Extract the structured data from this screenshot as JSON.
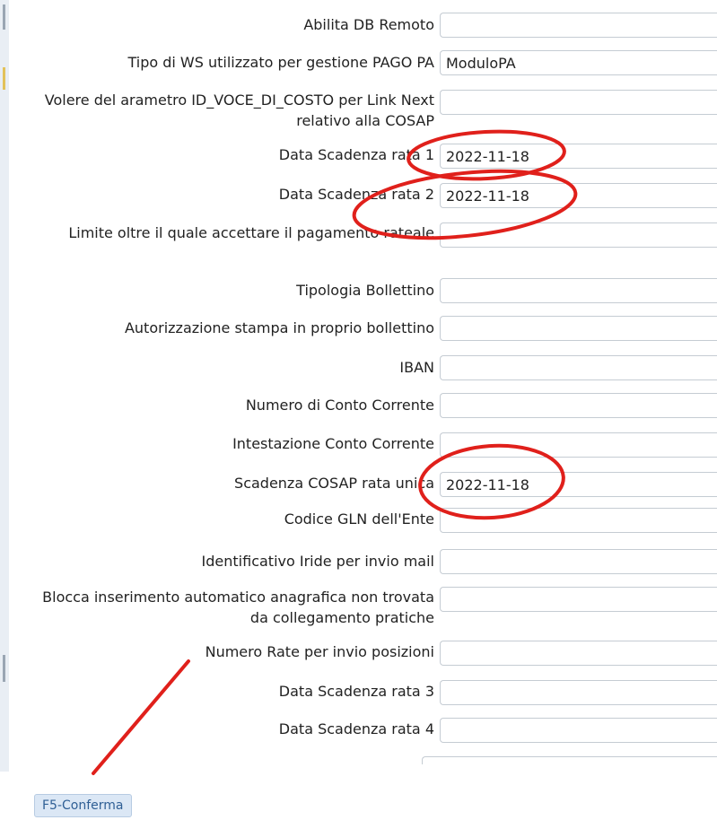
{
  "form": {
    "fields": [
      {
        "label": "Abilita DB Remoto",
        "value": ""
      },
      {
        "label": "Tipo di WS utilizzato per gestione PAGO PA",
        "value": "ModuloPA"
      },
      {
        "label": "Volere del arametro ID_VOCE_DI_COSTO per Link Next relativo alla COSAP",
        "value": ""
      },
      {
        "label": "Data Scadenza rata 1",
        "value": "2022-11-18"
      },
      {
        "label": "Data Scadenza rata 2",
        "value": "2022-11-18"
      },
      {
        "label": "Limite oltre il quale accettare il pagamento rateale",
        "value": ""
      },
      {
        "label": "Tipologia Bollettino",
        "value": ""
      },
      {
        "label": "Autorizzazione stampa in proprio bollettino",
        "value": ""
      },
      {
        "label": "IBAN",
        "value": ""
      },
      {
        "label": "Numero di Conto Corrente",
        "value": ""
      },
      {
        "label": "Intestazione Conto Corrente",
        "value": ""
      },
      {
        "label": "Scadenza COSAP rata unica",
        "value": "2022-11-18"
      },
      {
        "label": "Codice GLN dell'Ente",
        "value": ""
      },
      {
        "label": "Identificativo Iride per invio mail",
        "value": ""
      },
      {
        "label": "Blocca inserimento automatico anagrafica non trovata da collegamento pratiche",
        "value": ""
      },
      {
        "label": "Numero Rate per invio posizioni",
        "value": ""
      },
      {
        "label": "Data Scadenza rata 3",
        "value": ""
      },
      {
        "label": "Data Scadenza rata 4",
        "value": ""
      }
    ]
  },
  "footer": {
    "confirm_label": "F5-Conferma"
  },
  "colors": {
    "annotation": "#e0201b",
    "button_bg": "#dbe7f5",
    "button_text": "#2f5f95",
    "field_border": "#c5ccd3"
  }
}
